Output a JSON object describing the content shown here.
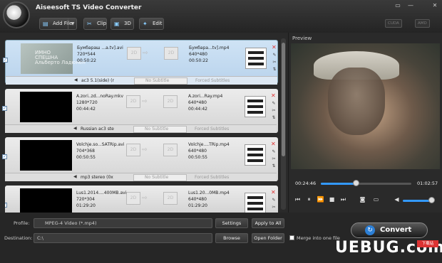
{
  "app": {
    "title": "Aiseesoft TS Video Converter"
  },
  "window_controls": [
    "▭",
    "—",
    "✕"
  ],
  "toolbar": {
    "add_file": "Add File",
    "clip": "Clip",
    "d3": "3D",
    "edit": "Edit",
    "cuda": "CUDA",
    "amd": "AMD"
  },
  "items": [
    {
      "src": "Бумбараш ...a.tv].avi",
      "src_res": "720*544",
      "src_dur": "00:50:22",
      "out": "Бумбара...tv].mp4",
      "out_res": "640*480",
      "out_dur": "00:50:22",
      "audio": "ac3 5.1(side) (r",
      "subtitle": "No Subtitle",
      "forced": "Forced Subtitles",
      "thumb_text": "ИМНО\nСПЕШНА\nАльберто Ладюнен"
    },
    {
      "src": "A.zori..zd...noRay.mkv",
      "src_res": "1280*720",
      "src_dur": "00:44:42",
      "out": "A.zori...Ray.mp4",
      "out_res": "640*480",
      "out_dur": "00:44:42",
      "audio": "Russian ac3 ste",
      "subtitle": "No Subtitle",
      "forced": "Forced Subtitles"
    },
    {
      "src": "Volchje.so...SATRip.avi",
      "src_res": "704*368",
      "src_dur": "00:50:55",
      "out": "Volchje....TRip.mp4",
      "out_res": "640*480",
      "out_dur": "00:50:55",
      "audio": "mp3 stereo (0x",
      "subtitle": "No Subtitle",
      "forced": "Forced Subtitles"
    },
    {
      "src": "Lus1.2014....400MB.avi",
      "src_res": "720*304",
      "src_dur": "01:29:20",
      "out": "Lus1.20...0MB.mp4",
      "out_res": "640*480",
      "out_dur": "01:29:20"
    }
  ],
  "preview": {
    "label": "Preview",
    "time_current": "00:24:46",
    "time_total": "01:02:57"
  },
  "footer": {
    "profile_label": "Profile:",
    "profile_value": "MPEG-4 Video (*.mp4)",
    "settings": "Settings",
    "apply_all": "Apply to All",
    "dest_label": "Destination:",
    "dest_value": "C:\\",
    "browse": "Browse",
    "open_folder": "Open Folder",
    "merge": "Merge into one file",
    "convert": "Convert"
  },
  "watermark": {
    "text": "UEBUG.com",
    "badge": "下载站"
  }
}
